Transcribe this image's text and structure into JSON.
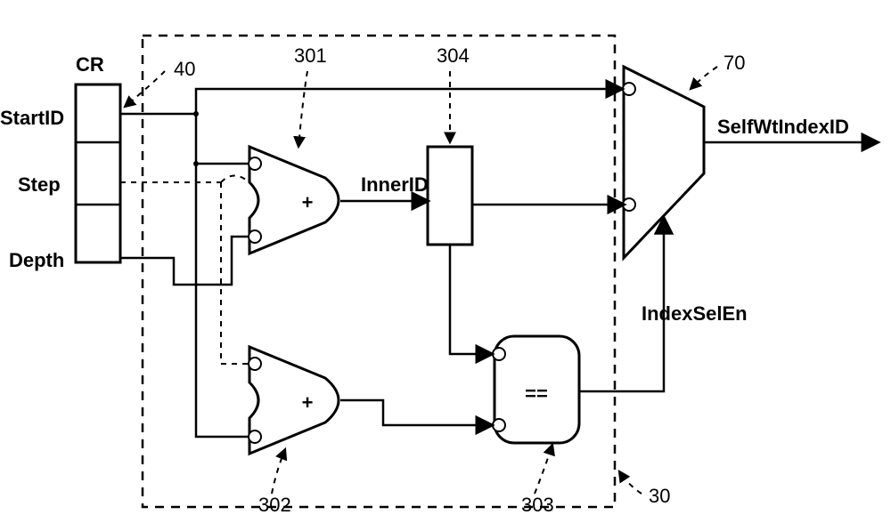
{
  "cr_header": "CR",
  "reg": {
    "startid": "StartID",
    "step": "Step",
    "depth": "Depth"
  },
  "signals": {
    "inner_id": "InnerID",
    "index_sel_en": "IndexSelEn",
    "self_wt_index_id": "SelfWtIndexID"
  },
  "ref": {
    "r40": "40",
    "r301": "301",
    "r304": "304",
    "r302": "302",
    "r303": "303",
    "r30": "30",
    "r70": "70"
  },
  "ops": {
    "add301": "+",
    "add302": "+",
    "eq303": "=="
  }
}
